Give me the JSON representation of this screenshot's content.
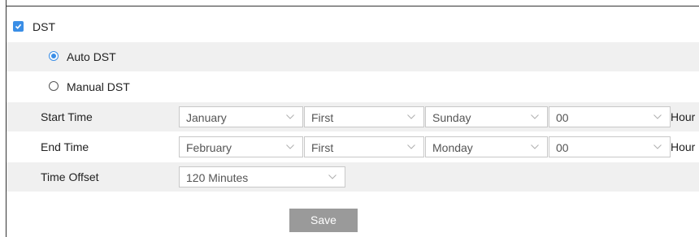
{
  "dst": {
    "label": "DST",
    "checked": true
  },
  "mode": {
    "auto_label": "Auto DST",
    "manual_label": "Manual DST",
    "selected": "Auto DST"
  },
  "start_time": {
    "label": "Start Time",
    "month": "January",
    "week": "First",
    "day": "Sunday",
    "hour": "00",
    "unit": "Hour"
  },
  "end_time": {
    "label": "End Time",
    "month": "February",
    "week": "First",
    "day": "Monday",
    "hour": "00",
    "unit": "Hour"
  },
  "time_offset": {
    "label": "Time Offset",
    "value": "120 Minutes"
  },
  "save_label": "Save",
  "colors": {
    "accent": "#3a8ee6",
    "row_shade": "#f0f0f0",
    "button": "#9a9a9a"
  },
  "icons": {
    "checkbox": "check-icon",
    "dropdown": "chevron-down-icon"
  }
}
